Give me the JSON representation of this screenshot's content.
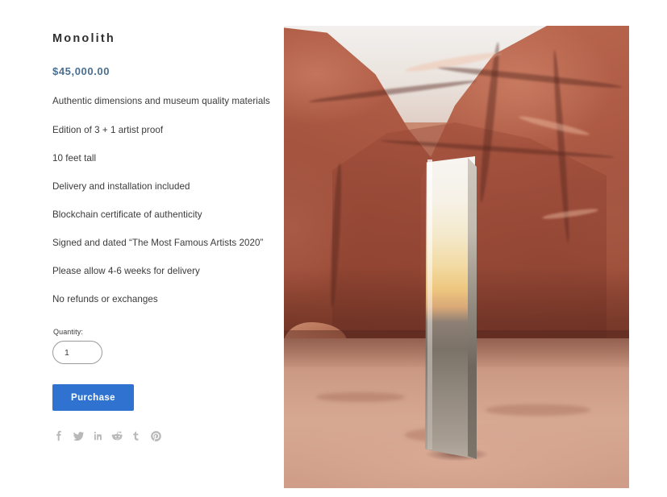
{
  "product": {
    "title": "Monolith",
    "price": "$45,000.00",
    "details": [
      "Authentic dimensions and museum quality materials",
      "Edition of 3 + 1 artist proof",
      "10 feet tall",
      "Delivery and installation included",
      "Blockchain certificate of authenticity",
      "Signed and dated “The Most Famous Artists 2020”",
      "Please allow 4-6 weeks for delivery",
      "No refunds or exchanges"
    ]
  },
  "quantity": {
    "label": "Quantity:",
    "value": "1",
    "placeholder": "1"
  },
  "purchase": {
    "label": "Purchase"
  },
  "social": {
    "items": [
      {
        "name": "facebook",
        "title": "Facebook"
      },
      {
        "name": "twitter",
        "title": "Twitter"
      },
      {
        "name": "linkedin",
        "title": "LinkedIn"
      },
      {
        "name": "reddit",
        "title": "Reddit"
      },
      {
        "name": "tumblr",
        "title": "Tumblr"
      },
      {
        "name": "pinterest",
        "title": "Pinterest"
      }
    ]
  },
  "hero": {
    "alt": "Reflective metal monolith standing on desert sand in a red rock canyon"
  },
  "colors": {
    "price": "#4a6f92",
    "button": "#2f72d0",
    "title": "#2f2f2f",
    "body_text": "#3a3a3a",
    "social_icon": "#b9b9b9",
    "rock": "#a85a47",
    "sand": "#d6a892"
  }
}
